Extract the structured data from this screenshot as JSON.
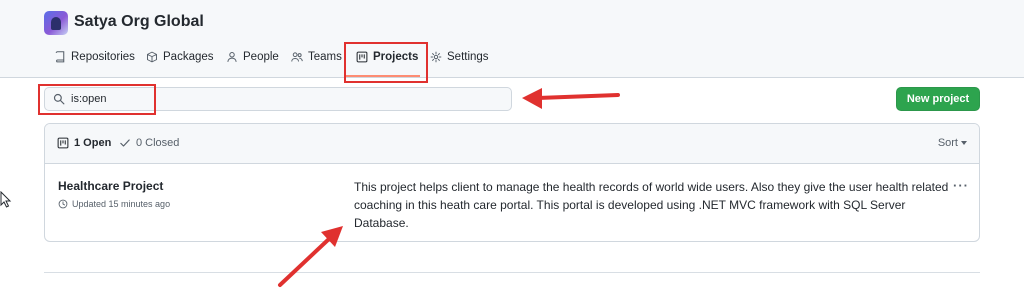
{
  "org": {
    "name": "Satya Org Global"
  },
  "nav": {
    "tabs": [
      {
        "label": "Repositories",
        "icon": "repo-icon"
      },
      {
        "label": "Packages",
        "icon": "package-icon"
      },
      {
        "label": "People",
        "icon": "person-icon"
      },
      {
        "label": "Teams",
        "icon": "people-icon"
      },
      {
        "label": "Projects",
        "icon": "project-icon",
        "selected": true
      },
      {
        "label": "Settings",
        "icon": "gear-icon"
      }
    ]
  },
  "search": {
    "value": "is:open",
    "icon": "search-icon"
  },
  "actions": {
    "new_project_label": "New project"
  },
  "projects_list": {
    "open_label": "1 Open",
    "closed_label": "0 Closed",
    "sort_label": "Sort",
    "items": [
      {
        "title": "Healthcare Project",
        "updated": "Updated 15 minutes ago",
        "description": "This project helps client to manage the health records of world wide users. Also they give the user health related coaching in this heath care portal. This portal is developed using .NET MVC framework with SQL Server Database."
      }
    ]
  },
  "colors": {
    "accent_green": "#2da44e",
    "selected_underline": "#fd8c73",
    "annotation_red": "#e0312f"
  }
}
